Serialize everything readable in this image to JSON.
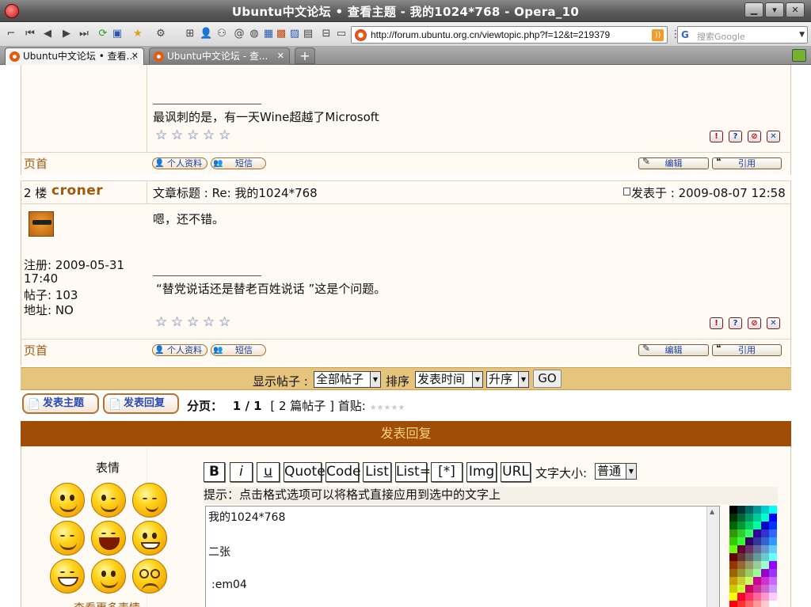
{
  "window": {
    "title": "Ubuntu中文论坛 • 查看主题 - 我的1024*768 - Opera_10"
  },
  "toolbar": {
    "url": "http://forum.ubuntu.org.cn/viewtopic.php?f=12&t=219379",
    "search_placeholder": "搜索Google",
    "search_engine": "G"
  },
  "tabs": [
    {
      "label": "Ubuntu中文论坛 • 查看...",
      "active": true
    },
    {
      "label": "Ubuntu中文论坛 - 查...",
      "active": false
    }
  ],
  "post1": {
    "signature": "最讽刺的是，有一天Wine超越了Microsoft",
    "first_page": "页首",
    "profile_label": "个人资料",
    "pm_label": "短信",
    "edit_label": "编辑",
    "quote_label": "引用"
  },
  "post2": {
    "floor": "2 楼",
    "author": "croner",
    "subject": "文章标题 : Re: 我的1024*768",
    "posted": "发表于 : 2009-08-07 12:58",
    "body": "嗯，还不错。",
    "signature": "“替党说话还是替老百姓说话 ”这是个问题。",
    "registered": "注册: 2009-05-31",
    "registered_time": "17:40",
    "posts": "帖子: 103",
    "location": "地址: NO",
    "first_page": "页首",
    "profile_label": "个人资料",
    "pm_label": "短信",
    "edit_label": "编辑",
    "quote_label": "引用"
  },
  "display_bar": {
    "show_label": "显示帖子 :",
    "show_value": "全部帖子",
    "sort_label": "排序",
    "sort_value": "发表时间",
    "order_value": "升序",
    "go_label": "GO"
  },
  "actions": {
    "new_topic": "发表主题",
    "reply": "发表回复",
    "pagination": "分页：",
    "page": "1 / 1",
    "post_count": "[ 2 篇帖子 ]",
    "first_post": "首贴:"
  },
  "reply": {
    "header": "发表回复",
    "smilies_title": "表情",
    "more_smilies": "查看更多表情",
    "format_buttons": [
      "B",
      "i",
      "u",
      "Quote",
      "Code",
      "List",
      "List=",
      "[*]",
      "Img",
      "URL"
    ],
    "font_size_label": "文字大小:",
    "font_size_value": "普通",
    "hint": "提示：点击格式选项可以将格式直接应用到选中的文字上",
    "text_lines": [
      "我的1024*768",
      "",
      "二张",
      "",
      ":em04"
    ]
  },
  "colors": {
    "accent": "#a04d08",
    "bar": "#e5c47e",
    "cream": "#fffaf3",
    "link": "#a05a10"
  }
}
